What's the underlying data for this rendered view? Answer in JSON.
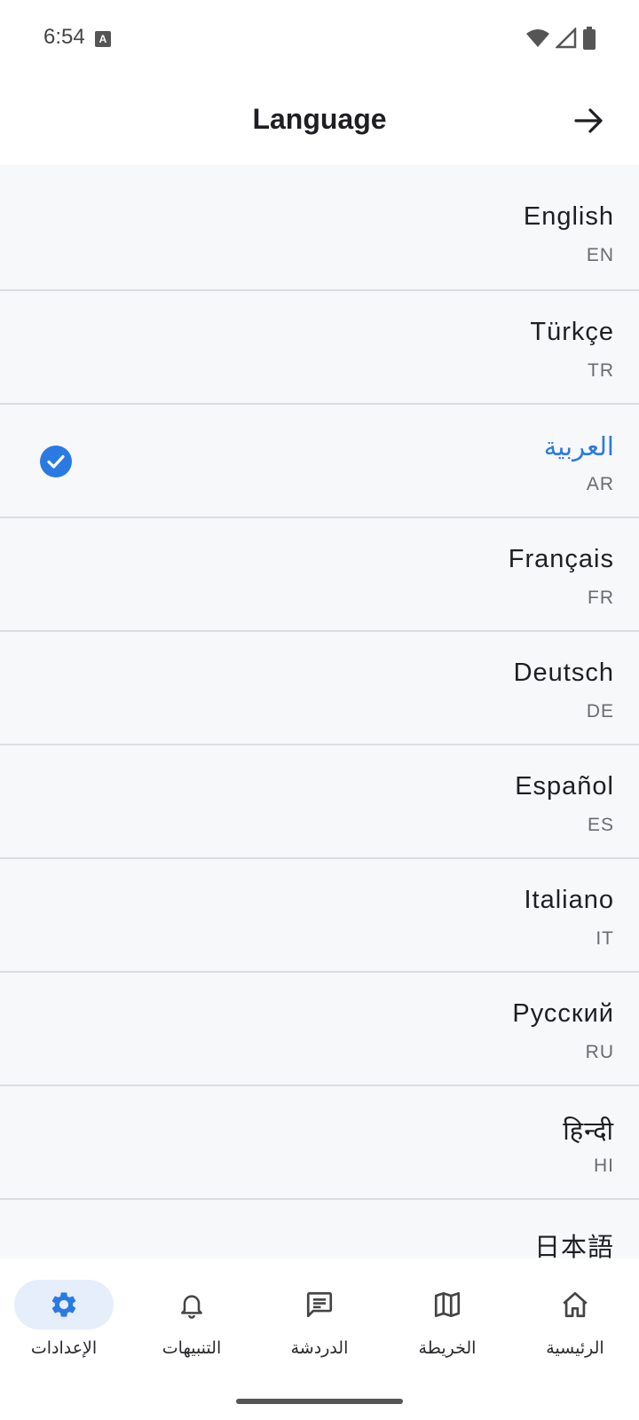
{
  "status_bar": {
    "time": "6:54",
    "notification_icon": "a-box-icon",
    "wifi_icon": "wifi-icon",
    "signal_icon": "cell-signal-icon",
    "battery_icon": "battery-icon"
  },
  "header": {
    "title": "Language",
    "back_icon": "arrow-right-icon"
  },
  "languages": [
    {
      "name": "English",
      "code": "EN",
      "selected": false
    },
    {
      "name": "Türkçe",
      "code": "TR",
      "selected": false
    },
    {
      "name": "العربية",
      "code": "AR",
      "selected": true
    },
    {
      "name": "Français",
      "code": "FR",
      "selected": false
    },
    {
      "name": "Deutsch",
      "code": "DE",
      "selected": false
    },
    {
      "name": "Español",
      "code": "ES",
      "selected": false
    },
    {
      "name": "Italiano",
      "code": "IT",
      "selected": false
    },
    {
      "name": "Русский",
      "code": "RU",
      "selected": false
    },
    {
      "name": "हिन्दी",
      "code": "HI",
      "selected": false
    },
    {
      "name": "日本語",
      "code": "",
      "selected": false
    }
  ],
  "bottom_nav": {
    "items": [
      {
        "label": "الإعدادات",
        "icon": "gear-icon",
        "active": true
      },
      {
        "label": "التنبيهات",
        "icon": "bell-icon",
        "active": false
      },
      {
        "label": "الدردشة",
        "icon": "chat-icon",
        "active": false
      },
      {
        "label": "الخريطة",
        "icon": "map-icon",
        "active": false
      },
      {
        "label": "الرئيسية",
        "icon": "home-icon",
        "active": false
      }
    ]
  },
  "colors": {
    "accent": "#2a7ae2",
    "list_background": "#f7f8fa",
    "active_pill": "#e6eefb"
  }
}
